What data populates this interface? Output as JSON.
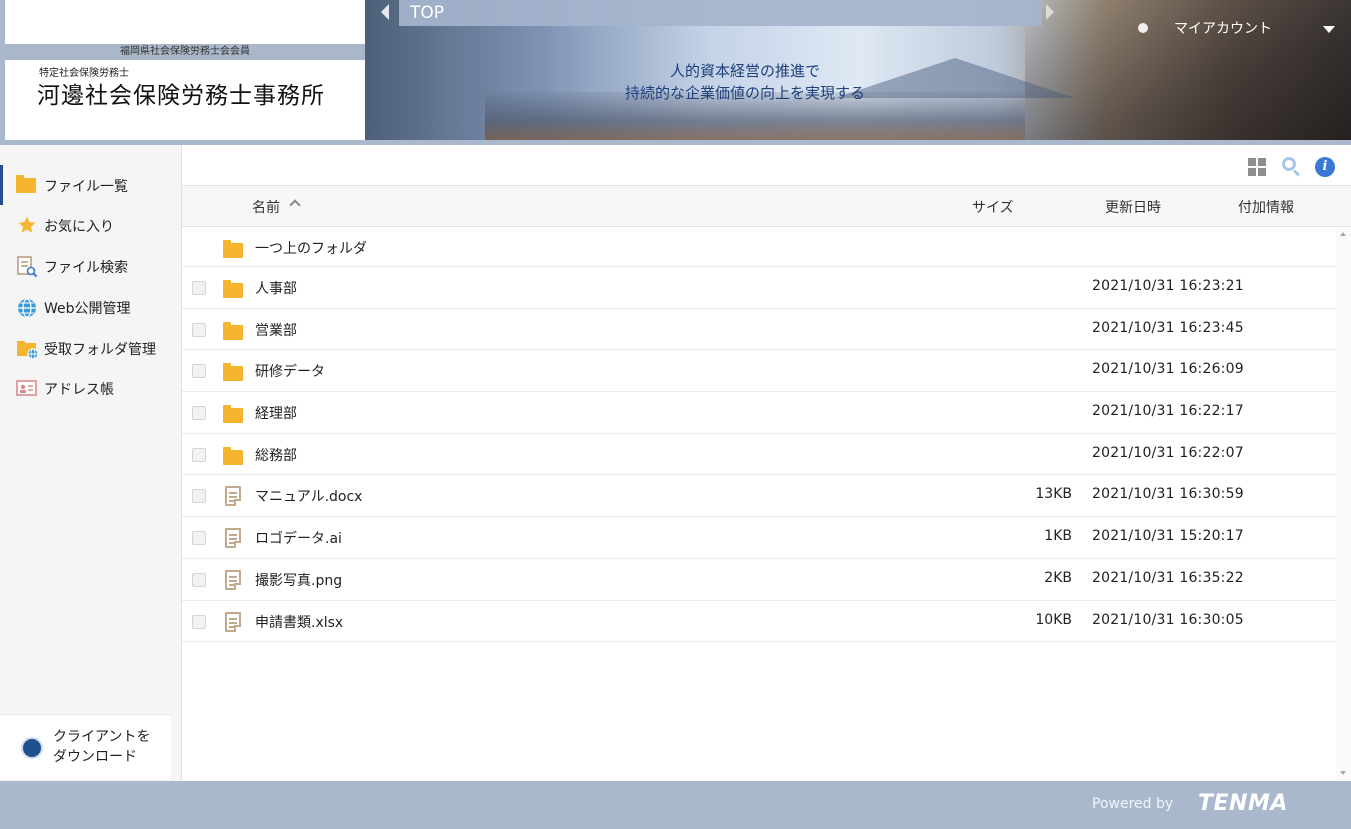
{
  "header": {
    "logo": {
      "band_text": "福岡県社会保険労務士会会員",
      "sub_text": "特定社会保険労務士",
      "office_name": "河邊社会保険労務士事務所"
    },
    "banner_slogan_line1": "人的資本経営の推進で",
    "banner_slogan_line2": "持続的な企業価値の向上を実現する",
    "breadcrumb": "TOP",
    "account_label": "マイアカウント"
  },
  "sidebar": {
    "items": [
      {
        "label": "ファイル一覧",
        "icon": "folder-icon",
        "active": true
      },
      {
        "label": "お気に入り",
        "icon": "star-icon"
      },
      {
        "label": "ファイル検索",
        "icon": "file-search-icon"
      },
      {
        "label": "Web公開管理",
        "icon": "globe-icon"
      },
      {
        "label": "受取フォルダ管理",
        "icon": "receive-folder-icon"
      },
      {
        "label": "アドレス帳",
        "icon": "address-book-icon"
      }
    ],
    "client_download_line1": "クライアントを",
    "client_download_line2": "ダウンロード"
  },
  "table": {
    "headers": {
      "name": "名前",
      "size": "サイズ",
      "date": "更新日時",
      "extra": "付加情報"
    },
    "parent_folder": "一つ上のフォルダ",
    "rows": [
      {
        "name": "人事部",
        "type": "folder",
        "size": "",
        "date": "2021/10/31 16:23:21"
      },
      {
        "name": "営業部",
        "type": "folder",
        "size": "",
        "date": "2021/10/31 16:23:45"
      },
      {
        "name": "研修データ",
        "type": "folder",
        "size": "",
        "date": "2021/10/31 16:26:09"
      },
      {
        "name": "経理部",
        "type": "folder",
        "size": "",
        "date": "2021/10/31 16:22:17"
      },
      {
        "name": "総務部",
        "type": "folder",
        "size": "",
        "date": "2021/10/31 16:22:07"
      },
      {
        "name": "マニュアル.docx",
        "type": "file",
        "size": "13KB",
        "date": "2021/10/31 16:30:59"
      },
      {
        "name": "ロゴデータ.ai",
        "type": "file",
        "size": "1KB",
        "date": "2021/10/31 15:20:17"
      },
      {
        "name": "撮影写真.png",
        "type": "file",
        "size": "2KB",
        "date": "2021/10/31 16:35:22"
      },
      {
        "name": "申請書類.xlsx",
        "type": "file",
        "size": "10KB",
        "date": "2021/10/31 16:30:05"
      }
    ]
  },
  "footer": {
    "powered_by": "Powered by",
    "brand": "TENMA"
  },
  "colors": {
    "accent": "#2a4e8c",
    "header_bg": "#a9b8cc",
    "folder": "#f6b52e",
    "info": "#3b78d6"
  }
}
